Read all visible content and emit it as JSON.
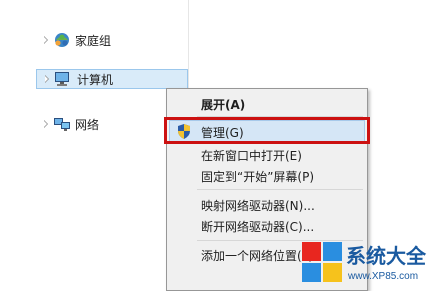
{
  "nav_tree": {
    "homegroup": {
      "label": "家庭组",
      "icon": "homegroup-icon"
    },
    "computer": {
      "label": "计算机",
      "icon": "computer-icon",
      "selected": true
    },
    "network": {
      "label": "网络",
      "icon": "network-icon"
    }
  },
  "context_menu": {
    "items": [
      {
        "label": "展开(A)",
        "bold": true
      },
      {
        "label": "管理(G)",
        "icon": "uac-shield-icon",
        "highlighted": true
      },
      {
        "label": "在新窗口中打开(E)"
      },
      {
        "label": "固定到“开始”屏幕(P)"
      },
      {
        "label": "映射网络驱动器(N)..."
      },
      {
        "label": "断开网络驱动器(C)..."
      },
      {
        "label": "添加一个网络位置(L)"
      }
    ]
  },
  "watermark": {
    "title": "系统大全",
    "url": "www.XP85.com"
  },
  "colors": {
    "selection": "#d9ebf9",
    "annotation_box": "#cc1111",
    "menu_bg": "#f0f0f0"
  }
}
